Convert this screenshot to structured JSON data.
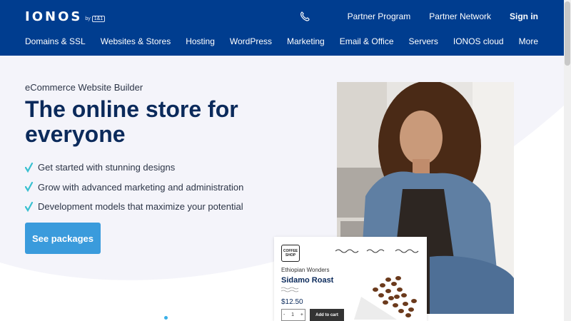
{
  "header": {
    "logo": "IONOS",
    "logo_by": "by",
    "logo_badge": "1&1",
    "top_links": [
      "Partner Program",
      "Partner Network",
      "Sign in"
    ],
    "nav": [
      "Domains & SSL",
      "Websites & Stores",
      "Hosting",
      "WordPress",
      "Marketing",
      "Email & Office",
      "Servers",
      "IONOS cloud"
    ],
    "more": "More",
    "colors": {
      "background": "#003d8f",
      "text": "#ffffff"
    }
  },
  "hero": {
    "eyebrow": "eCommerce Website Builder",
    "headline": "The online store for everyone",
    "features": [
      "Get started with stunning designs",
      "Grow with advanced marketing and administration",
      "Development models that maximize your potential"
    ],
    "cta": "See packages",
    "colors": {
      "accent": "#3a9bdc",
      "check": "#39c0d0",
      "headline": "#0b2a5b"
    }
  },
  "product_card": {
    "shop_logo": [
      "COFFEE",
      "SHOP"
    ],
    "origin": "Ethiopian Wonders",
    "name": "Sidamo Roast",
    "price": "$12.50",
    "quantity_minus": "-",
    "quantity": "1",
    "quantity_plus": "+",
    "add_to_cart": "Add to cart"
  },
  "icons": [
    "phone-icon",
    "check-icon",
    "coffee-beans-image",
    "woman-barista-photo"
  ]
}
